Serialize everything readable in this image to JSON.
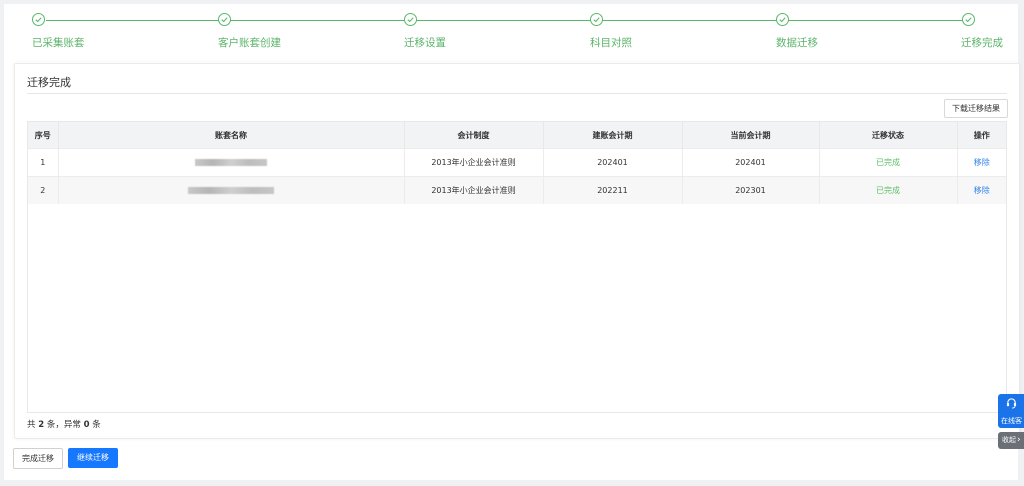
{
  "steps": [
    {
      "label": "已采集账套"
    },
    {
      "label": "客户账套创建"
    },
    {
      "label": "迁移设置"
    },
    {
      "label": "科目对照"
    },
    {
      "label": "数据迁移"
    },
    {
      "label": "迁移完成"
    }
  ],
  "colors": {
    "step_green": "#58b86a",
    "primary": "#1677ff",
    "status_done": "#5fc06a",
    "link": "#2f80ed"
  },
  "card": {
    "title": "迁移完成",
    "download_label": "下载迁移结果"
  },
  "table": {
    "headers": [
      "序号",
      "账套名称",
      "会计制度",
      "建账会计期",
      "当前会计期",
      "迁移状态",
      "操作"
    ],
    "rows": [
      {
        "index": "1",
        "name": "",
        "system": "2013年小企业会计准则",
        "start_period": "202401",
        "current_period": "202401",
        "status": "已完成",
        "action": "移除"
      },
      {
        "index": "2",
        "name": "",
        "system": "2013年小企业会计准则",
        "start_period": "202211",
        "current_period": "202301",
        "status": "已完成",
        "action": "移除"
      }
    ]
  },
  "summary": {
    "prefix": "共",
    "total": "2",
    "mid": "条，异常",
    "abnormal": "0",
    "suffix": "条"
  },
  "buttons": {
    "finish": "完成迁移",
    "continue": "继续迁移"
  },
  "float": {
    "service_label": "在线客",
    "collapse_label": "收起"
  },
  "icons": {
    "step": "check-circle-icon",
    "service": "headset-icon",
    "collapse": "chevron-right-icon"
  }
}
